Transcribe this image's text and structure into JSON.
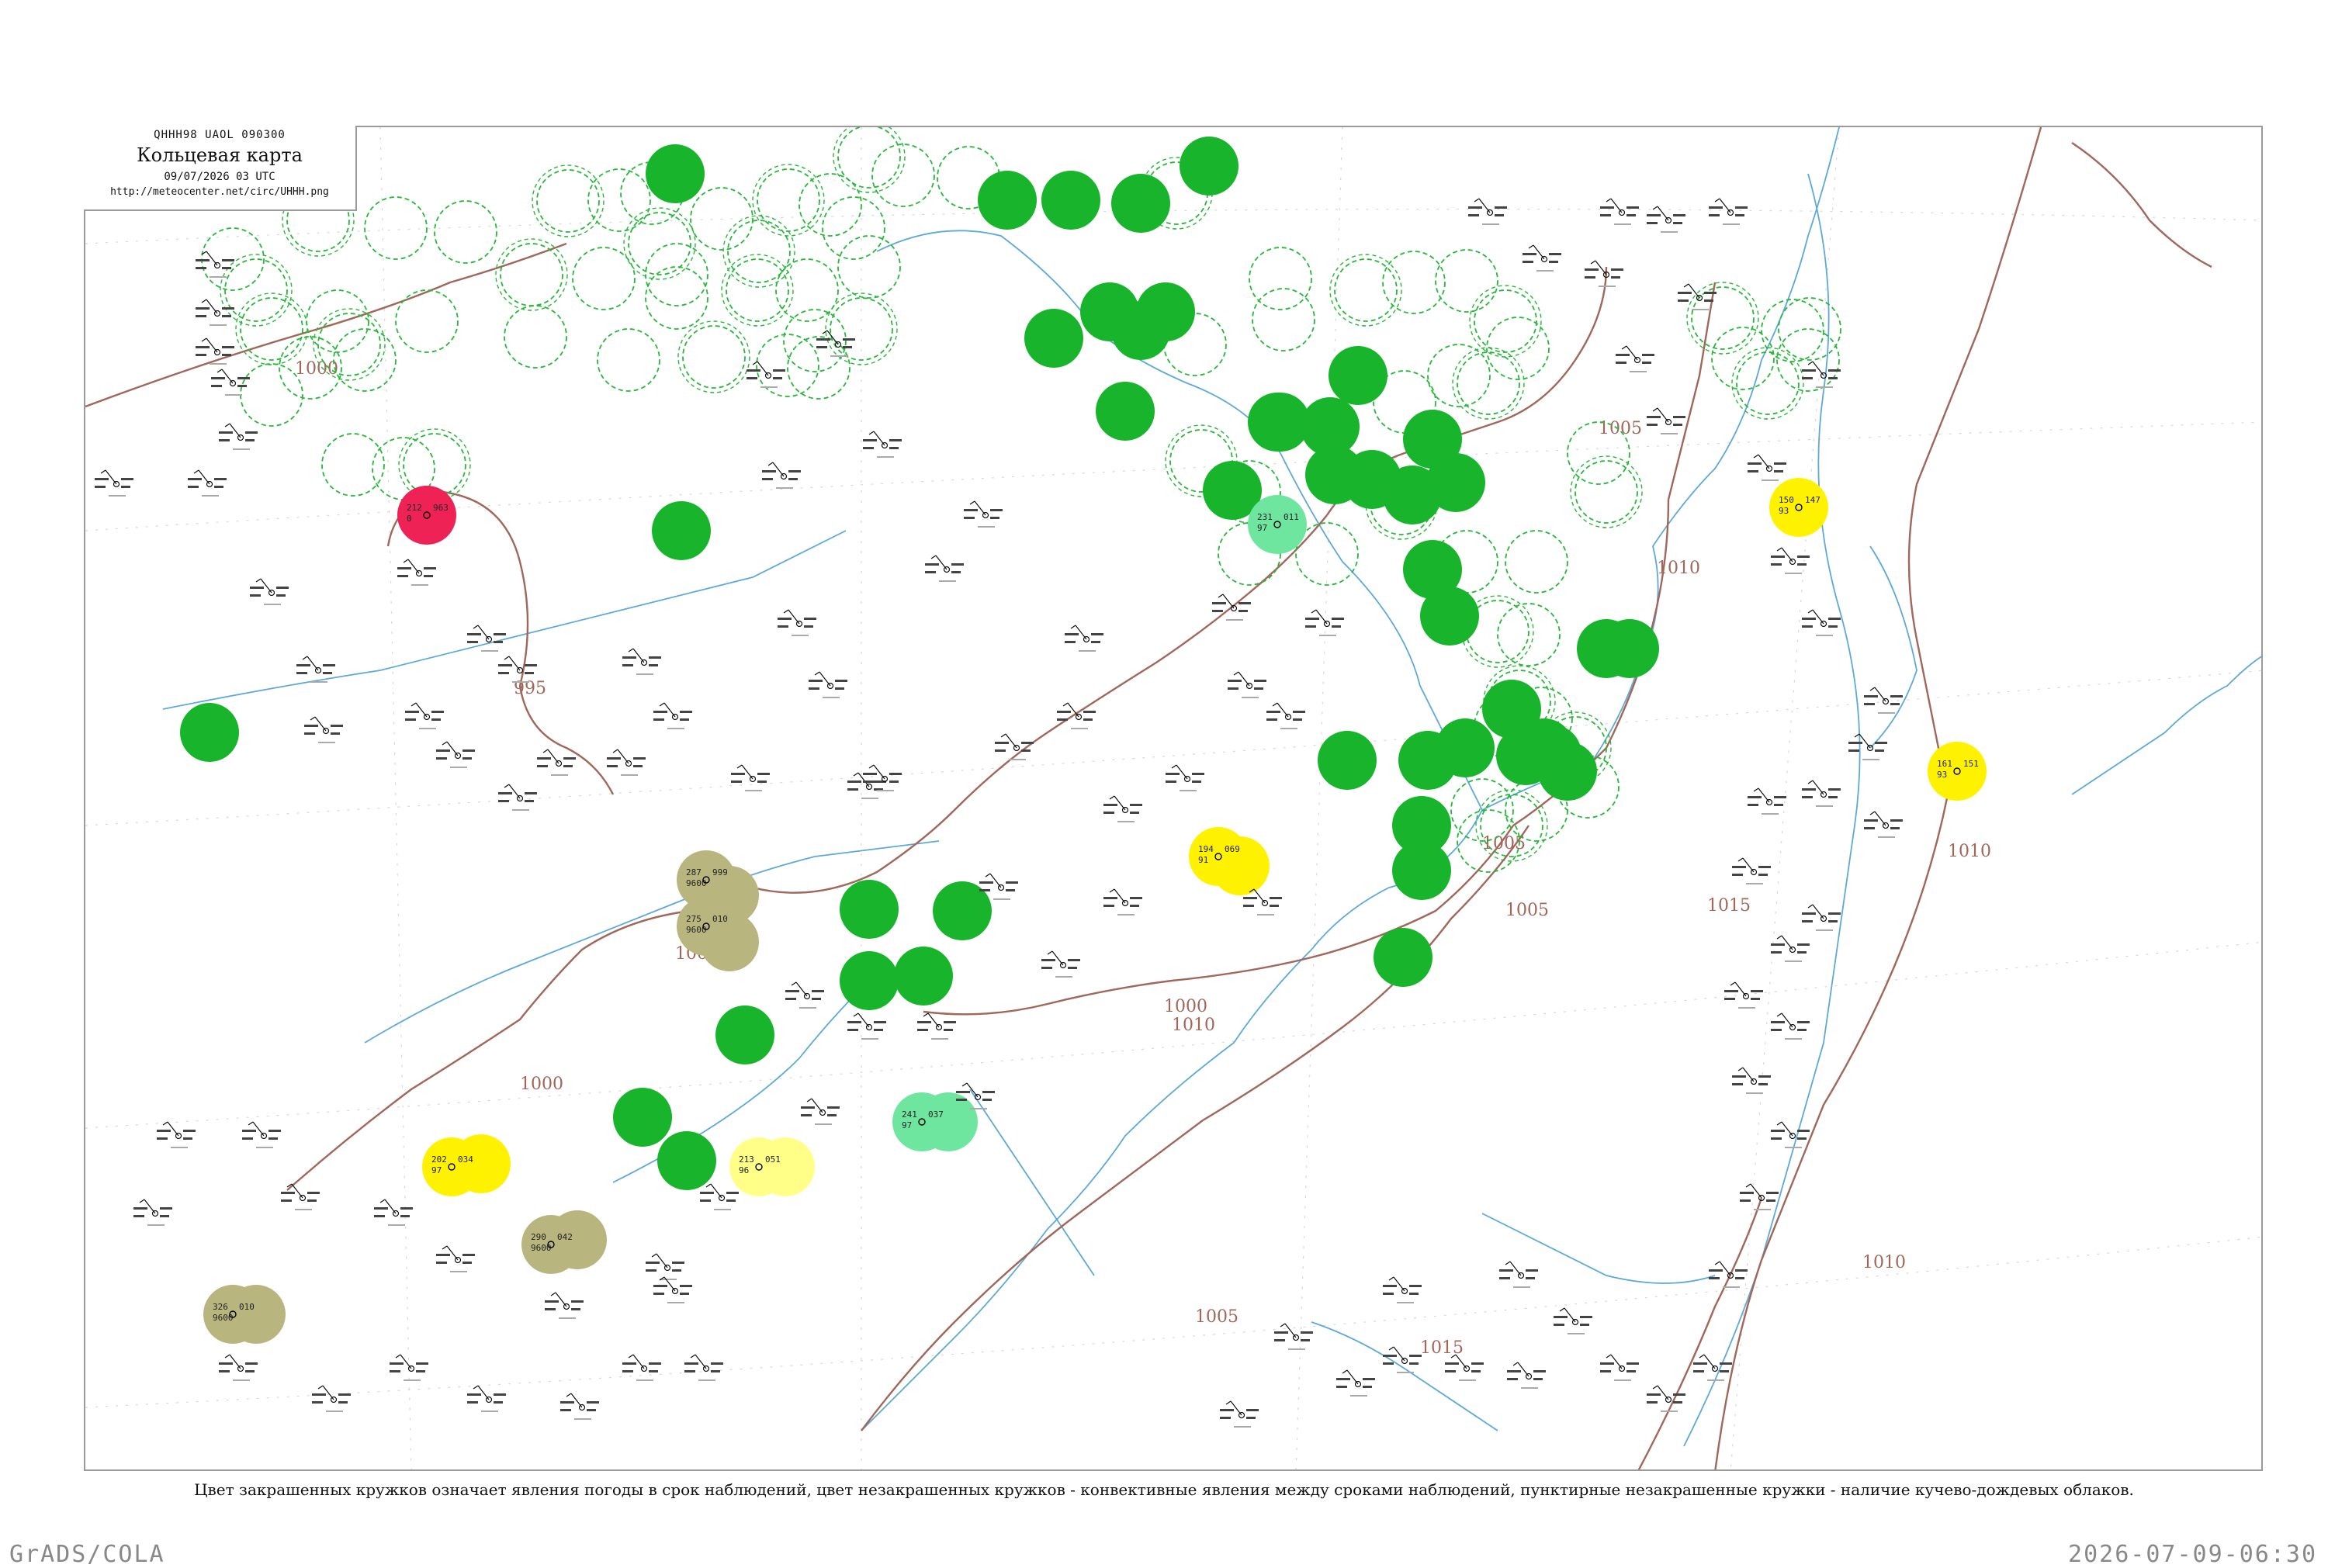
{
  "header": {
    "code": "QHHH98  UAOL  090300",
    "map_title": "Кольцевая карта",
    "timestamp": "09/07/2026 03 UTC",
    "url": "http://meteocenter.net/circ/UHHH.png"
  },
  "caption": "Цвет закрашенных кружков означает явления погоды в срок наблюдений, цвет незакрашенных кружков - конвективные явления между сроками наблюдений, пунктирные незакрашенные кружки - наличие кучево-дождевых облаков.",
  "footer": {
    "left": "GrADS/COLA",
    "right": "2026-07-09-06:30"
  },
  "colors": {
    "precip_green": "#18b52c",
    "light_green": "#6fe6a0",
    "yellow": "#fff200",
    "pale_yellow": "#ffff88",
    "olive": "#b8b67e",
    "red": "#ee2255",
    "isobar": "#a0675a",
    "coast": "#5da9d8",
    "ring": "#27b83a"
  },
  "isobar_labels": [
    "1000",
    "995",
    "1000",
    "1000",
    "1000",
    "1005",
    "1010",
    "1005",
    "1005",
    "1010",
    "1005",
    "1010",
    "1015",
    "1015",
    "1010"
  ],
  "stations": [
    {
      "t": "212",
      "td": "0",
      "p": "963",
      "color": "#ee2255",
      "kind": "filled"
    },
    {
      "t": "150",
      "td": "93",
      "p": "147",
      "color": "#fff200",
      "kind": "filled"
    },
    {
      "t": "161",
      "td": "93",
      "p": "151",
      "color": "#fff200",
      "kind": "filled"
    },
    {
      "t": "194",
      "td": "91",
      "p": "069",
      "color": "#fff200",
      "kind": "filled"
    },
    {
      "t": "202",
      "td": "97",
      "p": "034",
      "color": "#fff200",
      "kind": "filled"
    },
    {
      "t": "213",
      "td": "96",
      "p": "051",
      "color": "#ffff88",
      "kind": "filled"
    },
    {
      "t": "287",
      "td": "9600",
      "p": "999",
      "color": "#b8b67e",
      "kind": "filled"
    },
    {
      "t": "275",
      "td": "9600",
      "p": "010",
      "color": "#b8b67e",
      "kind": "filled"
    },
    {
      "t": "290",
      "td": "9600",
      "p": "042",
      "color": "#b8b67e",
      "kind": "filled"
    },
    {
      "t": "326",
      "td": "9600",
      "p": "010",
      "color": "#b8b67e",
      "kind": "filled"
    },
    {
      "t": "241",
      "td": "97",
      "p": "037",
      "color": "#6fe6a0",
      "kind": "filled"
    },
    {
      "t": "231",
      "td": "97",
      "p": "011",
      "color": "#6fe6a0",
      "kind": "filled"
    }
  ]
}
